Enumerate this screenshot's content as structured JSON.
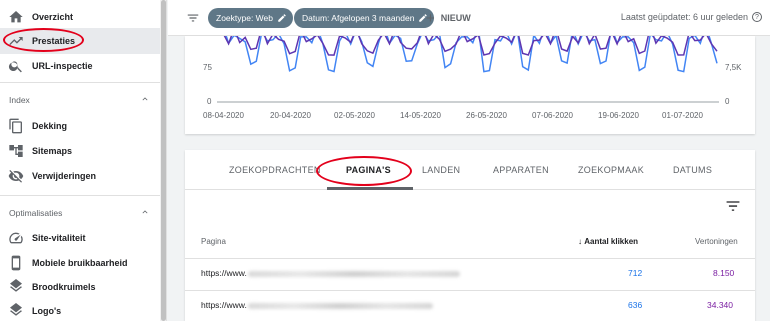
{
  "sidebar": {
    "items": [
      {
        "label": "Overzicht",
        "icon": "home-icon"
      },
      {
        "label": "Prestaties",
        "icon": "trending-up-icon",
        "active": true
      },
      {
        "label": "URL-inspectie",
        "icon": "search-icon"
      }
    ],
    "sections": [
      {
        "title": "Index",
        "items": [
          {
            "label": "Dekking",
            "icon": "copy-icon"
          },
          {
            "label": "Sitemaps",
            "icon": "sitemap-icon"
          },
          {
            "label": "Verwijderingen",
            "icon": "eye-off-icon"
          }
        ]
      },
      {
        "title": "Optimalisaties",
        "items": [
          {
            "label": "Site-vitaliteit",
            "icon": "speed-icon"
          },
          {
            "label": "Mobiele bruikbaarheid",
            "icon": "phone-icon"
          },
          {
            "label": "Broodkruimels",
            "icon": "layers-icon"
          },
          {
            "label": "Logo's",
            "icon": "layers-icon"
          }
        ]
      }
    ]
  },
  "topbar": {
    "chips": [
      "Zoektype: Web",
      "Datum: Afgelopen 3 maanden"
    ],
    "new_label": "NIEUW",
    "updated": "Laatst geüpdatet: 6 uur geleden",
    "help": "?"
  },
  "chart_data": {
    "type": "line",
    "x_ticks": [
      "08-04-2020",
      "20-04-2020",
      "02-05-2020",
      "14-05-2020",
      "26-05-2020",
      "07-06-2020",
      "19-06-2020",
      "01-07-2020"
    ],
    "y_left_ticks": [
      "75",
      "0"
    ],
    "y_right_ticks": [
      "7,5K",
      "0"
    ],
    "series": [
      {
        "color": "#4285f4"
      },
      {
        "color": "#5e35b1"
      }
    ]
  },
  "tabs": {
    "items": [
      "ZOEKOPDRACHTEN",
      "PAGINA'S",
      "LANDEN",
      "APPARATEN",
      "ZOEKOPMAAK",
      "DATUMS"
    ],
    "active": 1
  },
  "table": {
    "headers": {
      "page": "Pagina",
      "clicks": "Aantal klikken",
      "views": "Vertoningen"
    },
    "rows": [
      {
        "url": "https://www.",
        "clicks": "712",
        "views": "8.150"
      },
      {
        "url": "https://www.",
        "clicks": "636",
        "views": "34.340"
      }
    ]
  },
  "colors": {
    "accent_blue": "#1a73e8",
    "accent_purple": "#7b1fa2",
    "chip": "#5f7787",
    "annotation_red": "#e3001b"
  }
}
